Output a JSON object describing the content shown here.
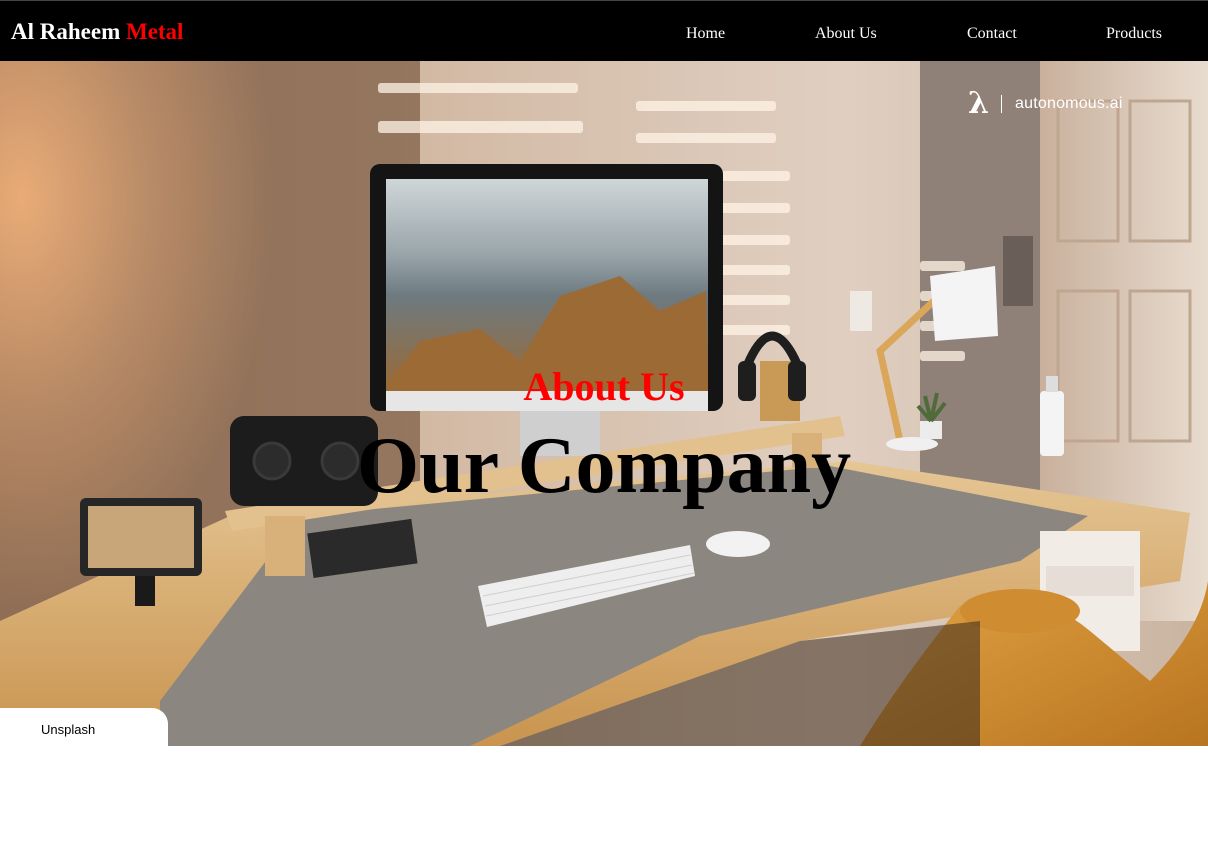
{
  "navbar": {
    "brand_primary": "Al Raheem",
    "brand_accent": "Metal",
    "links": [
      {
        "label": "Home"
      },
      {
        "label": "About Us"
      },
      {
        "label": "Contact"
      },
      {
        "label": "Products"
      }
    ]
  },
  "hero": {
    "watermark": {
      "icon": "lambda-logo-icon",
      "glyph": "λ",
      "text": "autonomous.ai"
    },
    "subtitle": "About Us",
    "title": "Our Company",
    "photo_credit": "Unsplash"
  },
  "colors": {
    "navbar_bg": "#000000",
    "brand_accent": "#ff0000",
    "subtitle": "#ff0000",
    "title": "#000000"
  }
}
